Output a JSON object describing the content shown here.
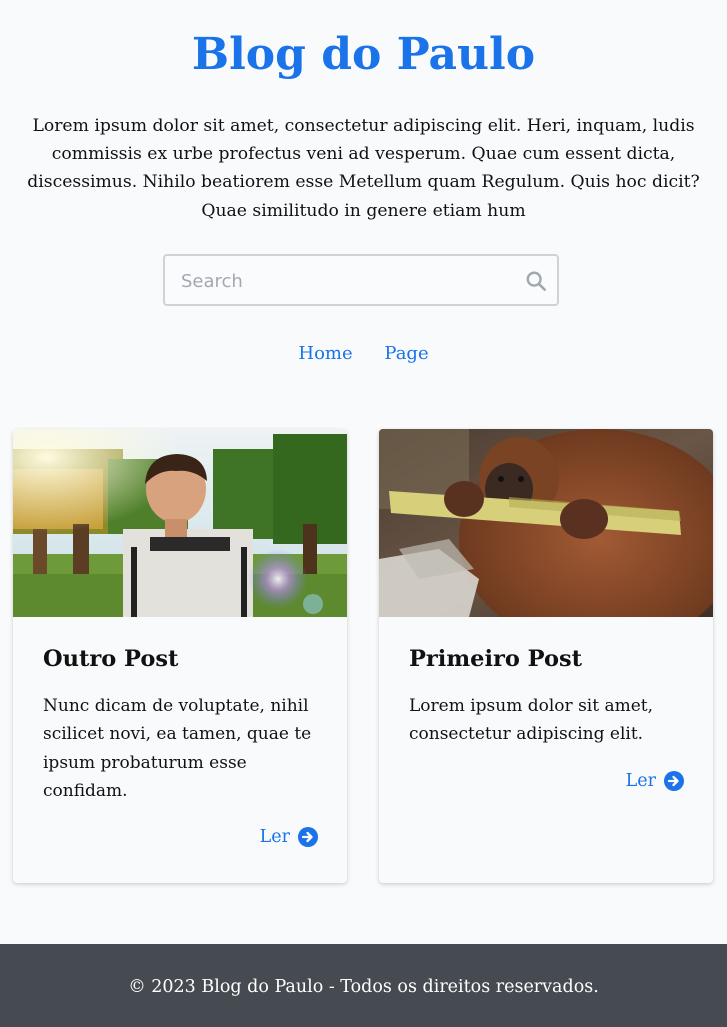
{
  "header": {
    "title": "Blog do Paulo",
    "intro": "Lorem ipsum dolor sit amet, consectetur adipiscing elit. Heri, inquam, ludis commissis ex urbe profectus veni ad vesperum. Quae cum essent dicta, discessimus. Nihilo beatiorem esse Metellum quam Regulum. Quis hoc dicit? Quae similitudo in genere etiam hum"
  },
  "search": {
    "placeholder": "Search",
    "value": "",
    "icon": "search-icon"
  },
  "nav": {
    "items": [
      {
        "label": "Home"
      },
      {
        "label": "Page"
      }
    ]
  },
  "posts": [
    {
      "title": "Outro Post",
      "excerpt": "Nunc dicam de voluptate, nihil scilicet novi, ea tamen, quae te ipsum probaturum esse confidam.",
      "link_label": "Ler",
      "link_icon": "arrow-right-circle-icon",
      "image_description": "boy in striped shirt in front of blocky game landscape"
    },
    {
      "title": "Primeiro Post",
      "excerpt": "Lorem ipsum dolor sit amet, consectetur adipiscing elit.",
      "link_label": "Ler",
      "link_icon": "arrow-right-circle-icon",
      "image_description": "young orangutan chewing sugar cane"
    }
  ],
  "footer": {
    "text": "© 2023 Blog do Paulo - Todos os direitos reservados."
  },
  "colors": {
    "accent": "#1a73e8",
    "background": "#f9fafc",
    "footer_bg": "#464b52"
  }
}
